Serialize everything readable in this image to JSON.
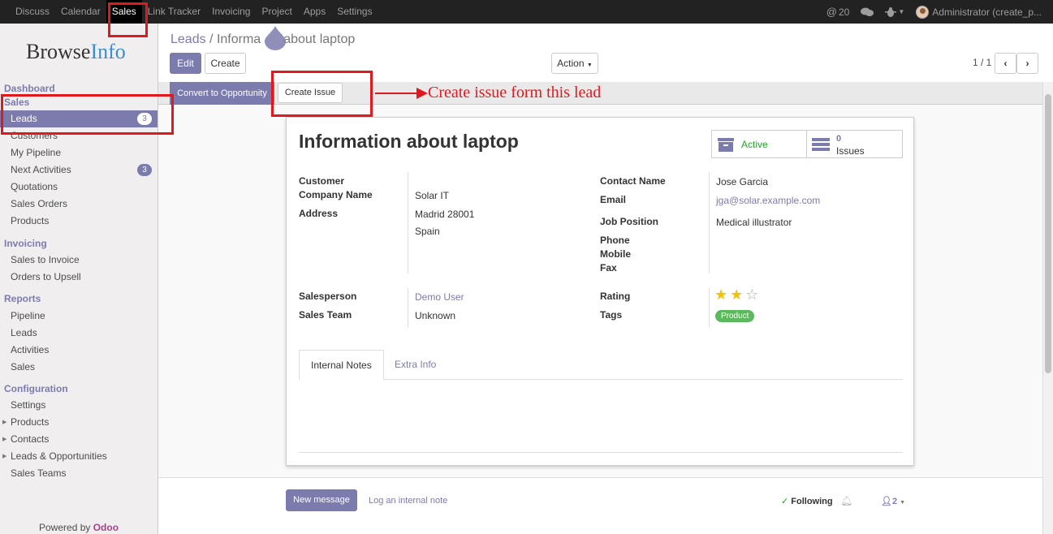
{
  "topbar": {
    "menu": [
      "Discuss",
      "Calendar",
      "Sales",
      "Link Tracker",
      "Invoicing",
      "Project",
      "Apps",
      "Settings"
    ],
    "active_menu": "Sales",
    "mentions_count": "20",
    "user_label": "Administrator (create_p..."
  },
  "logo": {
    "part1": "Browse",
    "part2": "Info"
  },
  "sidebar": {
    "dashboard": "Dashboard",
    "sales_section": "Sales",
    "sales_items": [
      {
        "label": "Leads",
        "badge": "3"
      },
      {
        "label": "Customers"
      },
      {
        "label": "My Pipeline"
      },
      {
        "label": "Next Activities",
        "badge": "3"
      },
      {
        "label": "Quotations"
      },
      {
        "label": "Sales Orders"
      },
      {
        "label": "Products"
      }
    ],
    "invoicing_section": "Invoicing",
    "invoicing_items": [
      "Sales to Invoice",
      "Orders to Upsell"
    ],
    "reports_section": "Reports",
    "reports_items": [
      "Pipeline",
      "Leads",
      "Activities",
      "Sales"
    ],
    "configuration_section": "Configuration",
    "configuration_items": [
      "Settings",
      "Products",
      "Contacts",
      "Leads & Opportunities",
      "Sales Teams"
    ],
    "powered_by": "Powered by",
    "powered_brand": "Odoo"
  },
  "breadcrumb": {
    "parent": "Leads",
    "separator": "/",
    "current_a": "Informa",
    "current_b": "about laptop"
  },
  "toolbar": {
    "edit": "Edit",
    "create": "Create",
    "action": "Action",
    "pager": "1 / 1"
  },
  "statusbar": {
    "convert": "Convert to Opportunity",
    "create_issue": "Create Issue"
  },
  "annotation": {
    "text": "Create issue form this lead"
  },
  "form": {
    "title": "Information about laptop",
    "active_label": "Active",
    "issues_count": "0",
    "issues_label": "Issues",
    "customer_label": "Customer",
    "company_label": "Company Name",
    "company_value": "Solar IT",
    "address_label": "Address",
    "address_line1": "Madrid 28001",
    "address_line2": "Spain",
    "contact_label": "Contact Name",
    "contact_value": "Jose Garcia",
    "email_label": "Email",
    "email_value": "jga@solar.example.com",
    "job_label": "Job Position",
    "job_value": "Medical illustrator",
    "phone_label": "Phone",
    "mobile_label": "Mobile",
    "fax_label": "Fax",
    "salesperson_label": "Salesperson",
    "salesperson_value": "Demo User",
    "team_label": "Sales Team",
    "team_value": "Unknown",
    "rating_label": "Rating",
    "rating_stars": 2,
    "rating_max": 3,
    "tags_label": "Tags",
    "tag_value": "Product",
    "tab_notes": "Internal Notes",
    "tab_extra": "Extra Info"
  },
  "chatter": {
    "new_message": "New message",
    "log_note": "Log an internal note",
    "following": "Following",
    "followers_count": "2"
  },
  "colors": {
    "accent": "#7c7bad",
    "topbar": "#222222",
    "highlight": "#e0191f",
    "tag_green": "#5cb85c",
    "star": "#f0c20a"
  }
}
